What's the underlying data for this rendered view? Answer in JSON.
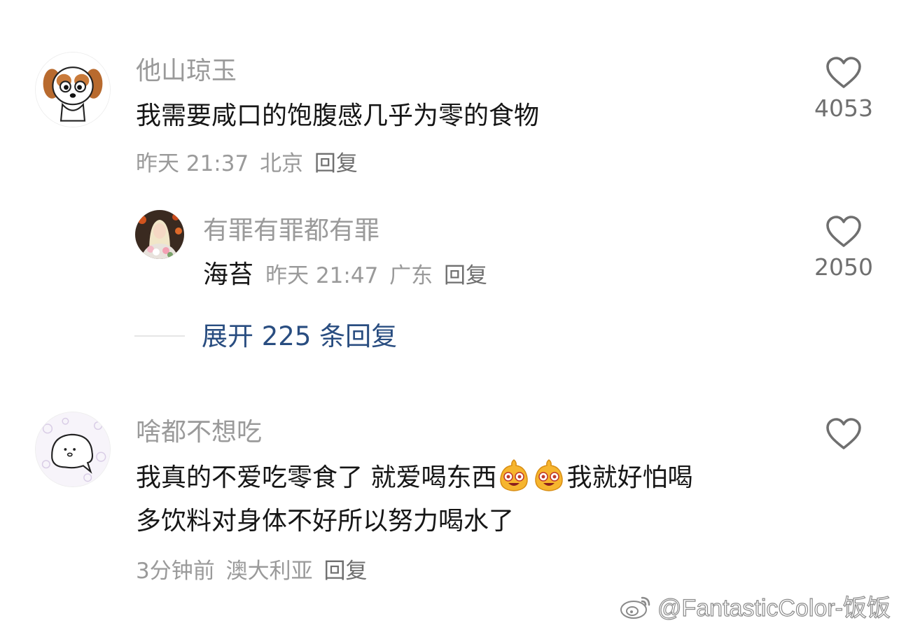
{
  "comments": [
    {
      "username": "他山琼玉",
      "text": "我需要咸口的饱腹感几乎为零的食物",
      "time": "昨天 21:37",
      "location": "北京",
      "reply_label": "回复",
      "likes": "4053",
      "replies": [
        {
          "username": "有罪有罪都有罪",
          "text": "海苔",
          "time": "昨天 21:47",
          "location": "广东",
          "reply_label": "回复",
          "likes": "2050"
        }
      ],
      "expand_label": "展开 225 条回复"
    },
    {
      "username": "啥都不想吃",
      "text_line1_part1": "我真的不爱吃零食了 就爱喝东西",
      "text_line1_part2": "我就好怕喝",
      "text_line2": "多饮料对身体不好所以努力喝水了",
      "time": "3分钟前",
      "location": "澳大利亚",
      "reply_label": "回复"
    }
  ],
  "watermark": "@FantasticColor-饭饭",
  "icons": {
    "like": "heart-outline-icon",
    "emoji": "laughing-emoji-icon",
    "weibo": "weibo-logo-icon"
  },
  "colors": {
    "username": "#9a9a9a",
    "text": "#161616",
    "link": "#294d80",
    "icon": "#6f6f6f"
  }
}
